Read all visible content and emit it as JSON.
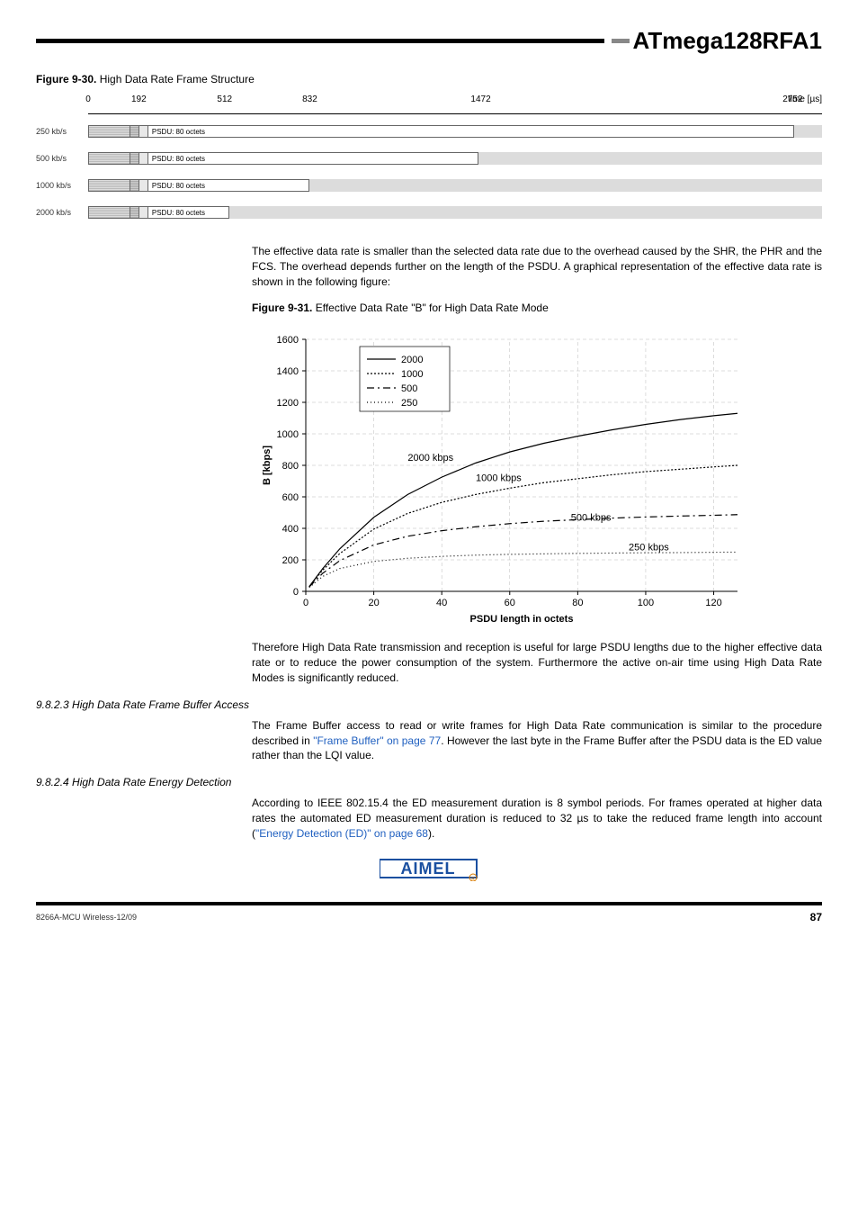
{
  "header": {
    "title": "ATmega128RFA1"
  },
  "fig30": {
    "caption_b": "Figure 9-30.",
    "caption": " High Data Rate Frame Structure",
    "axis_ticks": [
      "0",
      "192",
      "512",
      "832",
      "1472",
      "2752"
    ],
    "axis_label": "time [µs]",
    "rows": [
      {
        "label": "250 kb/s",
        "psdu": "PSDU: 80 octets"
      },
      {
        "label": "500 kb/s",
        "psdu": "PSDU: 80 octets"
      },
      {
        "label": "1000 kb/s",
        "psdu": "PSDU: 80 octets"
      },
      {
        "label": "2000 kb/s",
        "psdu": "PSDU: 80 octets"
      }
    ]
  },
  "para1": "The effective data rate is smaller than the selected data rate due to the overhead caused by the SHR, the PHR and the FCS. The overhead depends further on the length of the PSDU. A graphical representation of the effective data rate is shown in the following figure:",
  "fig31": {
    "caption_b": "Figure 9-31.",
    "caption": " Effective Data Rate \"B\" for High Data Rate Mode",
    "ylabel": "B [kbps]",
    "xlabel": "PSDU length in octets",
    "legend": [
      "2000",
      "1000",
      "500",
      "250"
    ],
    "annotations": [
      "2000 kbps",
      "1000 kbps",
      "500 kbps",
      "250 kbps"
    ],
    "y_ticks": [
      "0",
      "200",
      "400",
      "600",
      "800",
      "1000",
      "1200",
      "1400",
      "1600"
    ],
    "x_ticks": [
      "0",
      "20",
      "40",
      "60",
      "80",
      "100",
      "120"
    ]
  },
  "para2": "Therefore High Data Rate transmission and reception is useful for large PSDU lengths due to the higher effective data rate or to reduce the power consumption of the system. Furthermore the active on-air time using High Data Rate Modes is significantly reduced.",
  "sec3": {
    "heading": "9.8.2.3 High Data Rate Frame Buffer Access",
    "text_a": "The Frame Buffer access to read or write frames for High Data Rate communication is similar to the procedure described in ",
    "link": "\"Frame Buffer\" on page 77",
    "text_b": ". However the last byte in the Frame Buffer after the PSDU data is the ED value rather than the LQI value."
  },
  "sec4": {
    "heading": "9.8.2.4 High Data Rate Energy Detection",
    "text_a": "According to IEEE 802.15.4 the ED measurement duration is 8 symbol periods. For frames operated at higher data rates the automated ED measurement duration is reduced to 32 µs to take the reduced frame length into account (",
    "link": "\"Energy Detection (ED)\" on page 68",
    "text_b": ")."
  },
  "footer": {
    "left": "8266A-MCU Wireless-12/09",
    "page": "87"
  },
  "chart_data": {
    "type": "line",
    "xlabel": "PSDU length in octets",
    "ylabel": "B [kbps]",
    "x": [
      1,
      5,
      10,
      20,
      30,
      40,
      50,
      60,
      70,
      80,
      90,
      100,
      110,
      120,
      127
    ],
    "series": [
      {
        "name": "2000",
        "values": [
          30,
          145,
          270,
          470,
          615,
          725,
          815,
          885,
          940,
          985,
          1025,
          1060,
          1090,
          1115,
          1130
        ]
      },
      {
        "name": "1000",
        "values": [
          30,
          135,
          240,
          395,
          495,
          565,
          615,
          655,
          690,
          715,
          740,
          760,
          775,
          790,
          800
        ]
      },
      {
        "name": "500",
        "values": [
          28,
          115,
          195,
          295,
          350,
          385,
          410,
          430,
          445,
          455,
          465,
          472,
          478,
          483,
          487
        ]
      },
      {
        "name": "250",
        "values": [
          25,
          95,
          145,
          190,
          210,
          222,
          230,
          235,
          238,
          241,
          243,
          245,
          246,
          248,
          249
        ]
      }
    ],
    "xlim": [
      0,
      127
    ],
    "ylim": [
      0,
      1600
    ]
  }
}
